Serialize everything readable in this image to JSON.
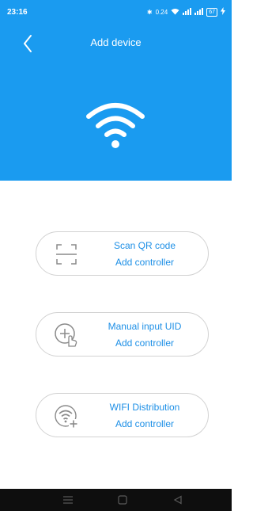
{
  "status": {
    "time": "23:16",
    "net_speed": "0.24",
    "battery": "67"
  },
  "header": {
    "title": "Add device",
    "back_icon": "chevron-left-icon",
    "hero_icon": "wifi-icon"
  },
  "options": [
    {
      "title": "Scan QR code",
      "subtitle": "Add controller",
      "icon": "qr-scan-icon"
    },
    {
      "title": "Manual input UID",
      "subtitle": "Add controller",
      "icon": "touch-add-icon"
    },
    {
      "title": "WIFI Distribution",
      "subtitle": "Add controller",
      "icon": "wifi-add-icon"
    }
  ],
  "colors": {
    "brand": "#1a9bf0",
    "link": "#1d8fe6",
    "card_border": "#d2d2d2"
  }
}
